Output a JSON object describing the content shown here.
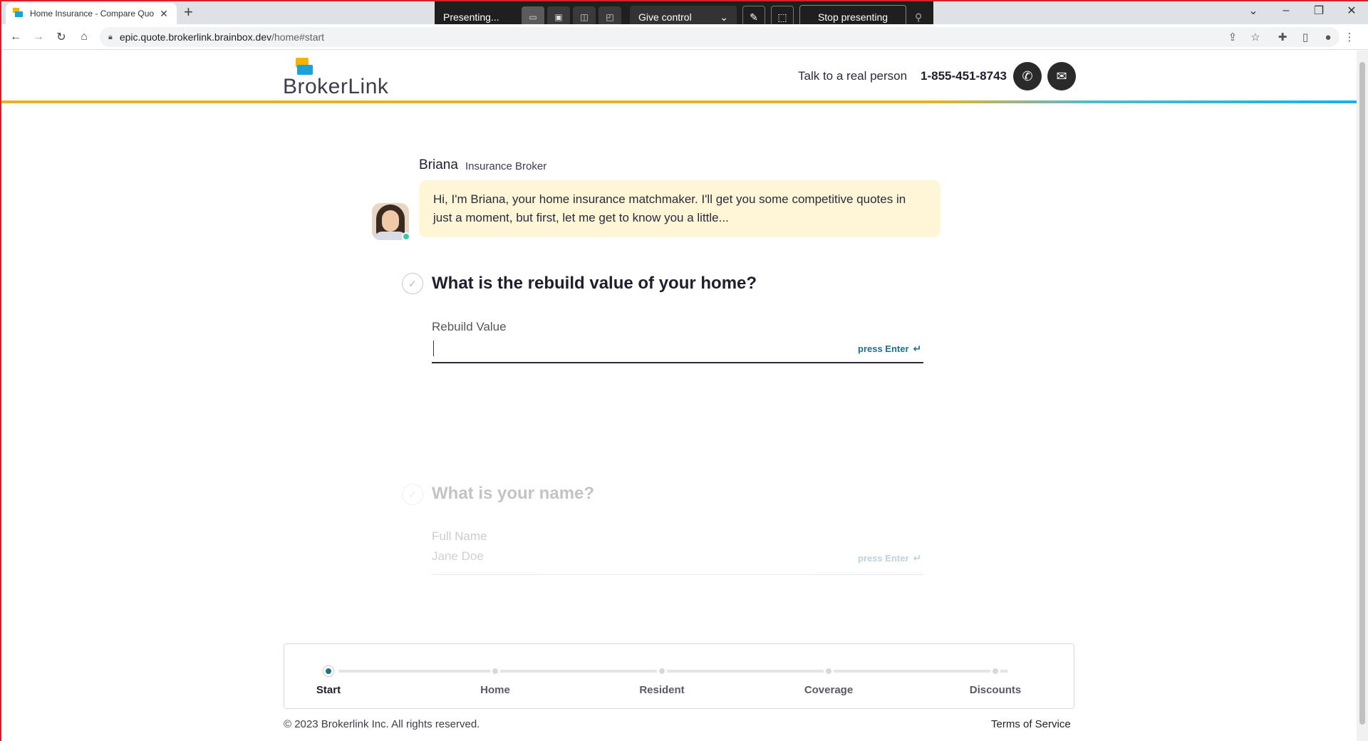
{
  "browser": {
    "tab_title": "Home Insurance - Compare Quo",
    "tab_close": "✕",
    "new_tab": "+",
    "url_host": "epic.quote.brokerlink.brainbox.dev",
    "url_path": "/home#start"
  },
  "presenting_bar": {
    "status": "Presenting...",
    "give_control": "Give control",
    "stop": "Stop presenting"
  },
  "header": {
    "logo_text": "BrokerLink",
    "talk_label": "Talk to a real person",
    "phone": "1-855-451-8743",
    "colors": {
      "gold": "#e8b12a",
      "teal": "#13b3e6"
    }
  },
  "agent": {
    "name": "Briana",
    "role": "Insurance Broker",
    "message": "Hi, I'm Briana, your home insurance matchmaker. I'll get you some competitive quotes in just a moment, but first, let me get to know you a little..."
  },
  "questions": [
    {
      "title": "What is the rebuild value of your home?",
      "label": "Rebuild Value",
      "value": "",
      "placeholder": "",
      "hint": "press Enter",
      "state": "active"
    },
    {
      "title": "What is your name?",
      "label": "Full Name",
      "value": "",
      "placeholder": "Jane Doe",
      "hint": "press Enter",
      "state": "upcoming"
    }
  ],
  "progress": {
    "steps": [
      "Start",
      "Home",
      "Resident",
      "Coverage",
      "Discounts"
    ],
    "current_index": 0,
    "accent": "#1d6f8c"
  },
  "footer": {
    "copyright": "© 2023 Brokerlink Inc. All rights reserved.",
    "terms": "Terms of Service"
  }
}
